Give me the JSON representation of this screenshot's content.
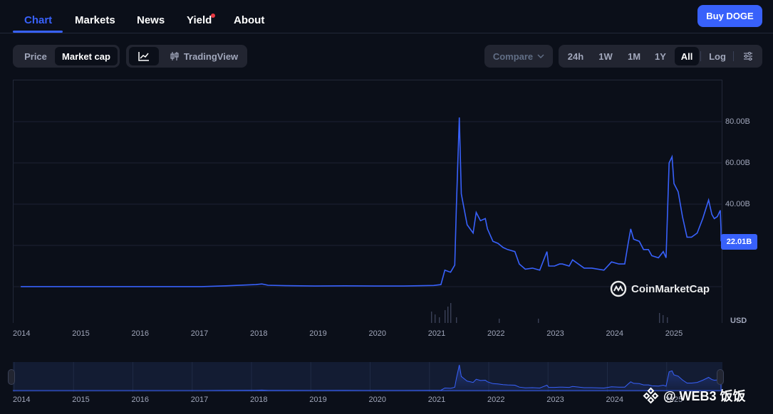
{
  "nav": {
    "tabs": [
      {
        "label": "Chart",
        "active": true
      },
      {
        "label": "Markets",
        "active": false
      },
      {
        "label": "News",
        "active": false
      },
      {
        "label": "Yield",
        "active": false,
        "has_dot": true
      },
      {
        "label": "About",
        "active": false
      }
    ],
    "buy_button": "Buy DOGE"
  },
  "toolbar": {
    "metric": {
      "price": "Price",
      "market_cap": "Market cap",
      "selected": "Market cap"
    },
    "view": {
      "line_icon": "line-chart-icon",
      "tradingview_icon": "candlestick-icon",
      "tradingview": "TradingView"
    },
    "compare": "Compare",
    "ranges": [
      "24h",
      "1W",
      "1M",
      "1Y",
      "All",
      "Log"
    ],
    "selected_range": "All",
    "settings_icon": "sliders-icon"
  },
  "colors": {
    "accent": "#3861fb",
    "background": "#0b0f19",
    "line": "#3861fb",
    "dot": "#ea3943"
  },
  "chart_data": {
    "type": "area",
    "title": "",
    "xlabel": "",
    "ylabel": "USD",
    "yticks": [
      "80.00B",
      "60.00B",
      "40.00B"
    ],
    "ylim": [
      0,
      80
    ],
    "current_value_label": "22.01B",
    "xticks": [
      "2014",
      "2015",
      "2016",
      "2017",
      "2018",
      "2019",
      "2020",
      "2021",
      "2022",
      "2023",
      "2024",
      "2025"
    ],
    "series": [
      {
        "unit": "B USD",
        "x": [
          "2013-12-15",
          "2014-06-01",
          "2015-01-01",
          "2015-06-01",
          "2016-01-01",
          "2016-06-01",
          "2017-01-01",
          "2017-06-01",
          "2017-12-01",
          "2018-01-08",
          "2018-02-15",
          "2018-06-01",
          "2018-12-01",
          "2019-06-01",
          "2019-12-01",
          "2020-06-01",
          "2020-12-01",
          "2021-01-15",
          "2021-02-08",
          "2021-03-15",
          "2021-04-10",
          "2021-04-20",
          "2021-05-08",
          "2021-05-20",
          "2021-06-01",
          "2021-06-25",
          "2021-08-01",
          "2021-08-20",
          "2021-09-15",
          "2021-10-15",
          "2021-10-28",
          "2021-12-01",
          "2022-01-01",
          "2022-02-01",
          "2022-03-01",
          "2022-04-15",
          "2022-05-12",
          "2022-06-18",
          "2022-08-01",
          "2022-09-15",
          "2022-10-29",
          "2022-11-09",
          "2022-12-15",
          "2023-01-15",
          "2023-02-01",
          "2023-03-15",
          "2023-04-05",
          "2023-06-15",
          "2023-08-01",
          "2023-10-15",
          "2023-12-01",
          "2024-01-15",
          "2024-02-20",
          "2024-03-10",
          "2024-03-28",
          "2024-04-15",
          "2024-05-20",
          "2024-06-15",
          "2024-07-15",
          "2024-08-05",
          "2024-09-15",
          "2024-10-15",
          "2024-11-01",
          "2024-11-20",
          "2024-12-08",
          "2024-12-20",
          "2025-01-15",
          "2025-02-10",
          "2025-03-10",
          "2025-04-07",
          "2025-05-12",
          "2025-06-15",
          "2025-07-21",
          "2025-08-10",
          "2025-08-25",
          "2025-09-13",
          "2025-10-01",
          "2025-10-10",
          "2025-10-20"
        ],
        "values": [
          0.05,
          0.03,
          0.02,
          0.02,
          0.02,
          0.03,
          0.03,
          0.4,
          1.0,
          1.3,
          0.7,
          0.5,
          0.3,
          0.4,
          0.3,
          0.3,
          0.6,
          1.0,
          8.0,
          7.0,
          10.5,
          39,
          82,
          45,
          40,
          30,
          26,
          36,
          32,
          33,
          28,
          22,
          21,
          19,
          18,
          17,
          11,
          8.5,
          9,
          8,
          17,
          10,
          10,
          11,
          11,
          10,
          13,
          9,
          9,
          8,
          12,
          11,
          11,
          20,
          28,
          23,
          22,
          18,
          18,
          15,
          14,
          17,
          14,
          60,
          63,
          50,
          46,
          34,
          24,
          24,
          26,
          33,
          42,
          35,
          33,
          34,
          37,
          28,
          22
        ]
      }
    ],
    "legend": "none",
    "grid": true,
    "navigator_xticks": [
      "2014",
      "2015",
      "2016",
      "2017",
      "2018",
      "2019",
      "2020",
      "2021",
      "2022",
      "2023",
      "2024",
      "2025"
    ]
  },
  "watermark": {
    "logo_text": "CoinMarketCap",
    "social_text": "@ WEB3 饭饭"
  }
}
